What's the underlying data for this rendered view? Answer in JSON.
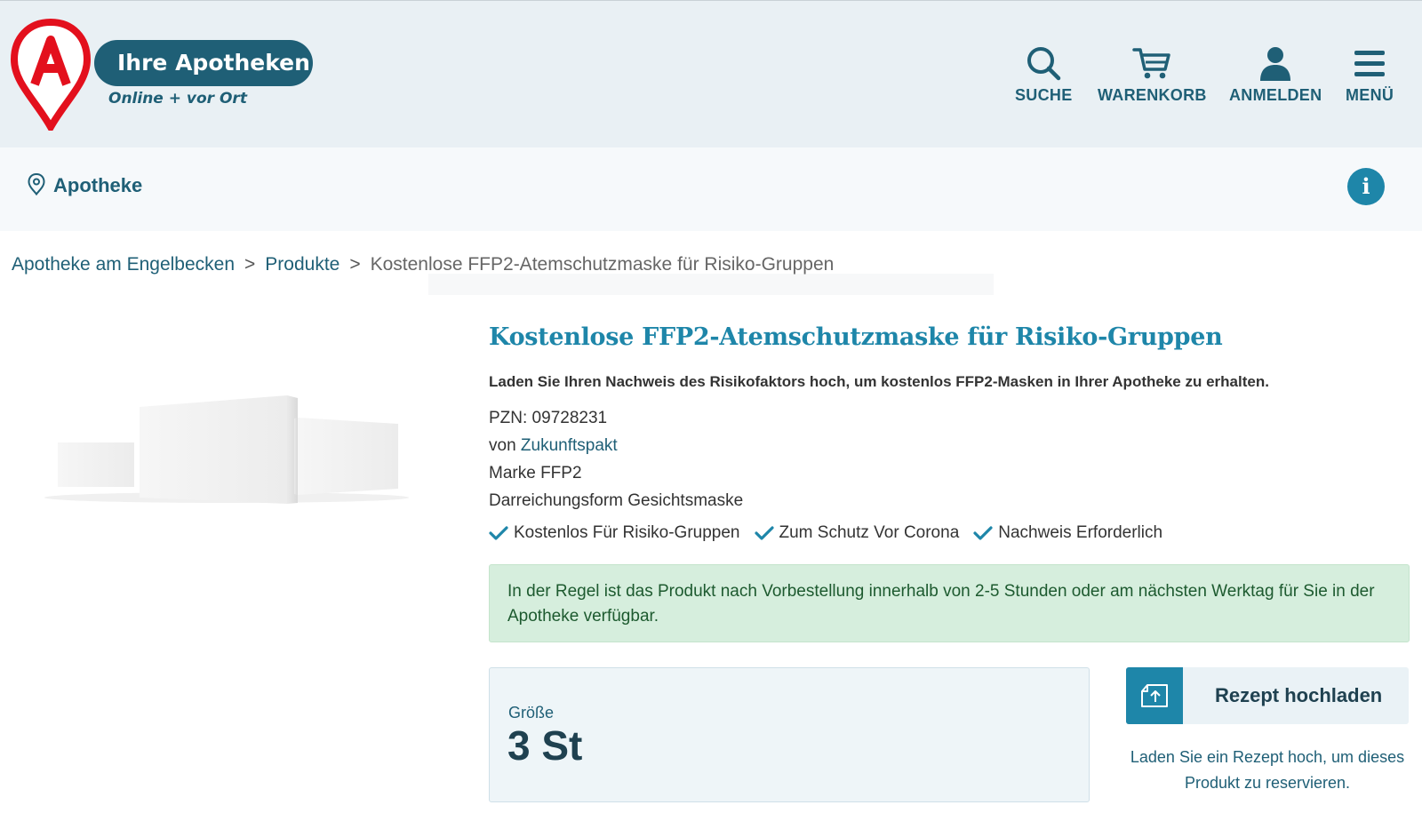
{
  "header": {
    "logo_text": "Ihre Apotheken",
    "logo_sub": "Online + vor Ort",
    "nav": [
      {
        "label": "SUCHE",
        "icon": "search-icon"
      },
      {
        "label": "WARENKORB",
        "icon": "cart-icon"
      },
      {
        "label": "ANMELDEN",
        "icon": "user-icon"
      },
      {
        "label": "MENÜ",
        "icon": "hamburger-icon"
      }
    ]
  },
  "apotheke_bar": {
    "label": "Apotheke",
    "icon": "location-pin-icon",
    "info_icon": "info-icon"
  },
  "breadcrumb": {
    "items": [
      "Apotheke am Engelbecken",
      "Produkte",
      "Kostenlose FFP2-Atemschutzmaske für Risiko-Gruppen"
    ],
    "separator": ">"
  },
  "product": {
    "title": "Kostenlose FFP2-Atemschutzmaske für Risiko-Gruppen",
    "subtitle": "Laden Sie Ihren Nachweis des Risikofaktors hoch, um kostenlos FFP2-Masken in Ihrer Apotheke zu erhalten.",
    "pzn": "PZN: 09728231",
    "vendor_prefix": "von",
    "vendor": "Zukunftspakt",
    "brand": "Marke FFP2",
    "form": "Darreichungsform Gesichtsmaske",
    "features": [
      "Kostenlos Für Risiko-Gruppen",
      "Zum Schutz Vor Corona",
      "Nachweis Erforderlich"
    ],
    "availability": "In der Regel ist das Produkt nach Vorbestellung innerhalb von 2-5 Stunden oder am nächsten Werktag für Sie in der Apotheke verfügbar.",
    "size_label": "Größe",
    "size_value": "3 St",
    "upload_label": "Rezept hochladen",
    "upload_hint": "Laden Sie ein Rezept hoch, um dieses Produkt zu reservieren."
  },
  "colors": {
    "brand_dark": "#1f5f76",
    "brand_accent": "#1e86a9",
    "logo_red": "#e3101d",
    "notice_bg": "#d6eedd"
  }
}
